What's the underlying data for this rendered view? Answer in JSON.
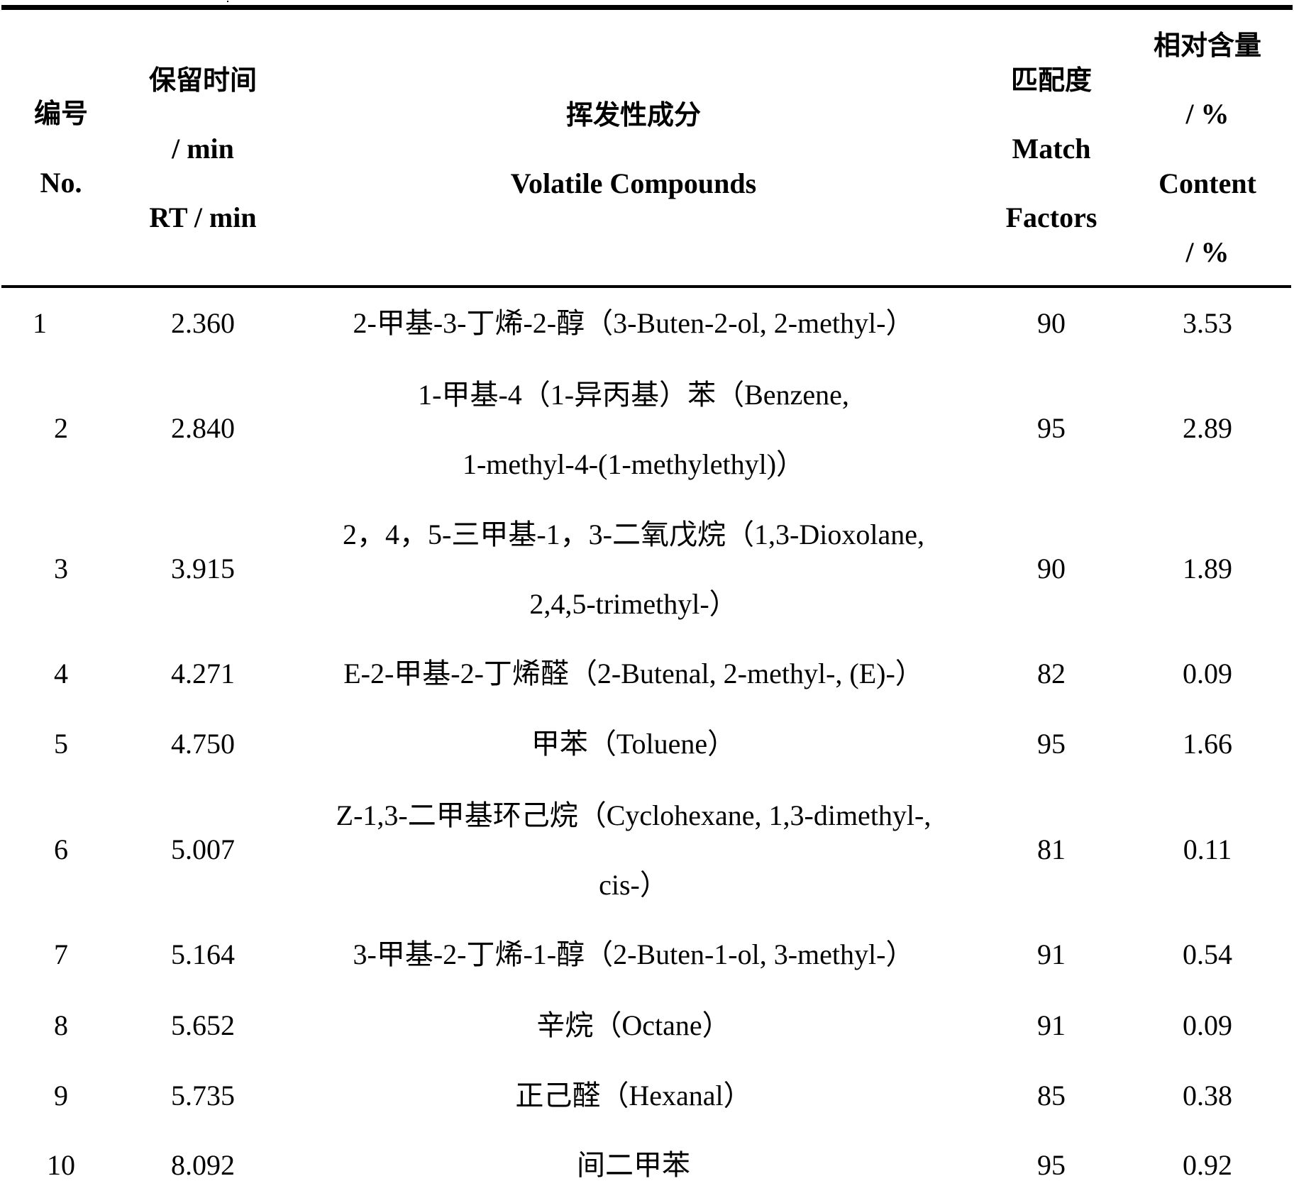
{
  "table": {
    "headers": {
      "no": {
        "cn": "编号",
        "en": "No."
      },
      "rt": {
        "cn": "保留时间",
        "unit_cn": "/ min",
        "en": "RT / min"
      },
      "compound": {
        "cn": "挥发性成分",
        "en": "Volatile Compounds"
      },
      "match": {
        "cn": "匹配度",
        "en_1": "Match",
        "en_2": "Factors"
      },
      "content": {
        "cn": "相对含量",
        "unit_cn": "/ %",
        "en": "Content",
        "unit_en": "/ %"
      }
    },
    "rows": [
      {
        "no": "1",
        "rt": "2.360",
        "compound_lines": [
          "2-甲基-3-丁烯-2-醇（3-Buten-2-ol, 2-methyl-）"
        ],
        "match": "90",
        "content": "3.53"
      },
      {
        "no": "2",
        "rt": "2.840",
        "compound_lines": [
          "1-甲基-4（1-异丙基）苯（Benzene,",
          "1-methyl-4-(1-methylethyl)）"
        ],
        "match": "95",
        "content": "2.89"
      },
      {
        "no": "3",
        "rt": "3.915",
        "compound_lines": [
          "2，4，5-三甲基-1，3-二氧戊烷（1,3-Dioxolane,",
          "2,4,5-trimethyl-）"
        ],
        "match": "90",
        "content": "1.89"
      },
      {
        "no": "4",
        "rt": "4.271",
        "compound_lines": [
          "E-2-甲基-2-丁烯醛（2-Butenal, 2-methyl-, (E)-）"
        ],
        "match": "82",
        "content": "0.09"
      },
      {
        "no": "5",
        "rt": "4.750",
        "compound_lines": [
          "甲苯（Toluene）"
        ],
        "match": "95",
        "content": "1.66"
      },
      {
        "no": "6",
        "rt": "5.007",
        "compound_lines": [
          "Z-1,3-二甲基环己烷（Cyclohexane, 1,3-dimethyl-,",
          "cis-）"
        ],
        "match": "81",
        "content": "0.11"
      },
      {
        "no": "7",
        "rt": "5.164",
        "compound_lines": [
          "3-甲基-2-丁烯-1-醇（2-Buten-1-ol, 3-methyl-）"
        ],
        "match": "91",
        "content": "0.54"
      },
      {
        "no": "8",
        "rt": "5.652",
        "compound_lines": [
          "辛烷（Octane）"
        ],
        "match": "91",
        "content": "0.09"
      },
      {
        "no": "9",
        "rt": "5.735",
        "compound_lines": [
          "正己醛（Hexanal）"
        ],
        "match": "85",
        "content": "0.38"
      },
      {
        "no": "10",
        "rt": "8.092",
        "compound_lines": [
          "间二甲苯"
        ],
        "match": "95",
        "content": "0.92"
      }
    ]
  }
}
